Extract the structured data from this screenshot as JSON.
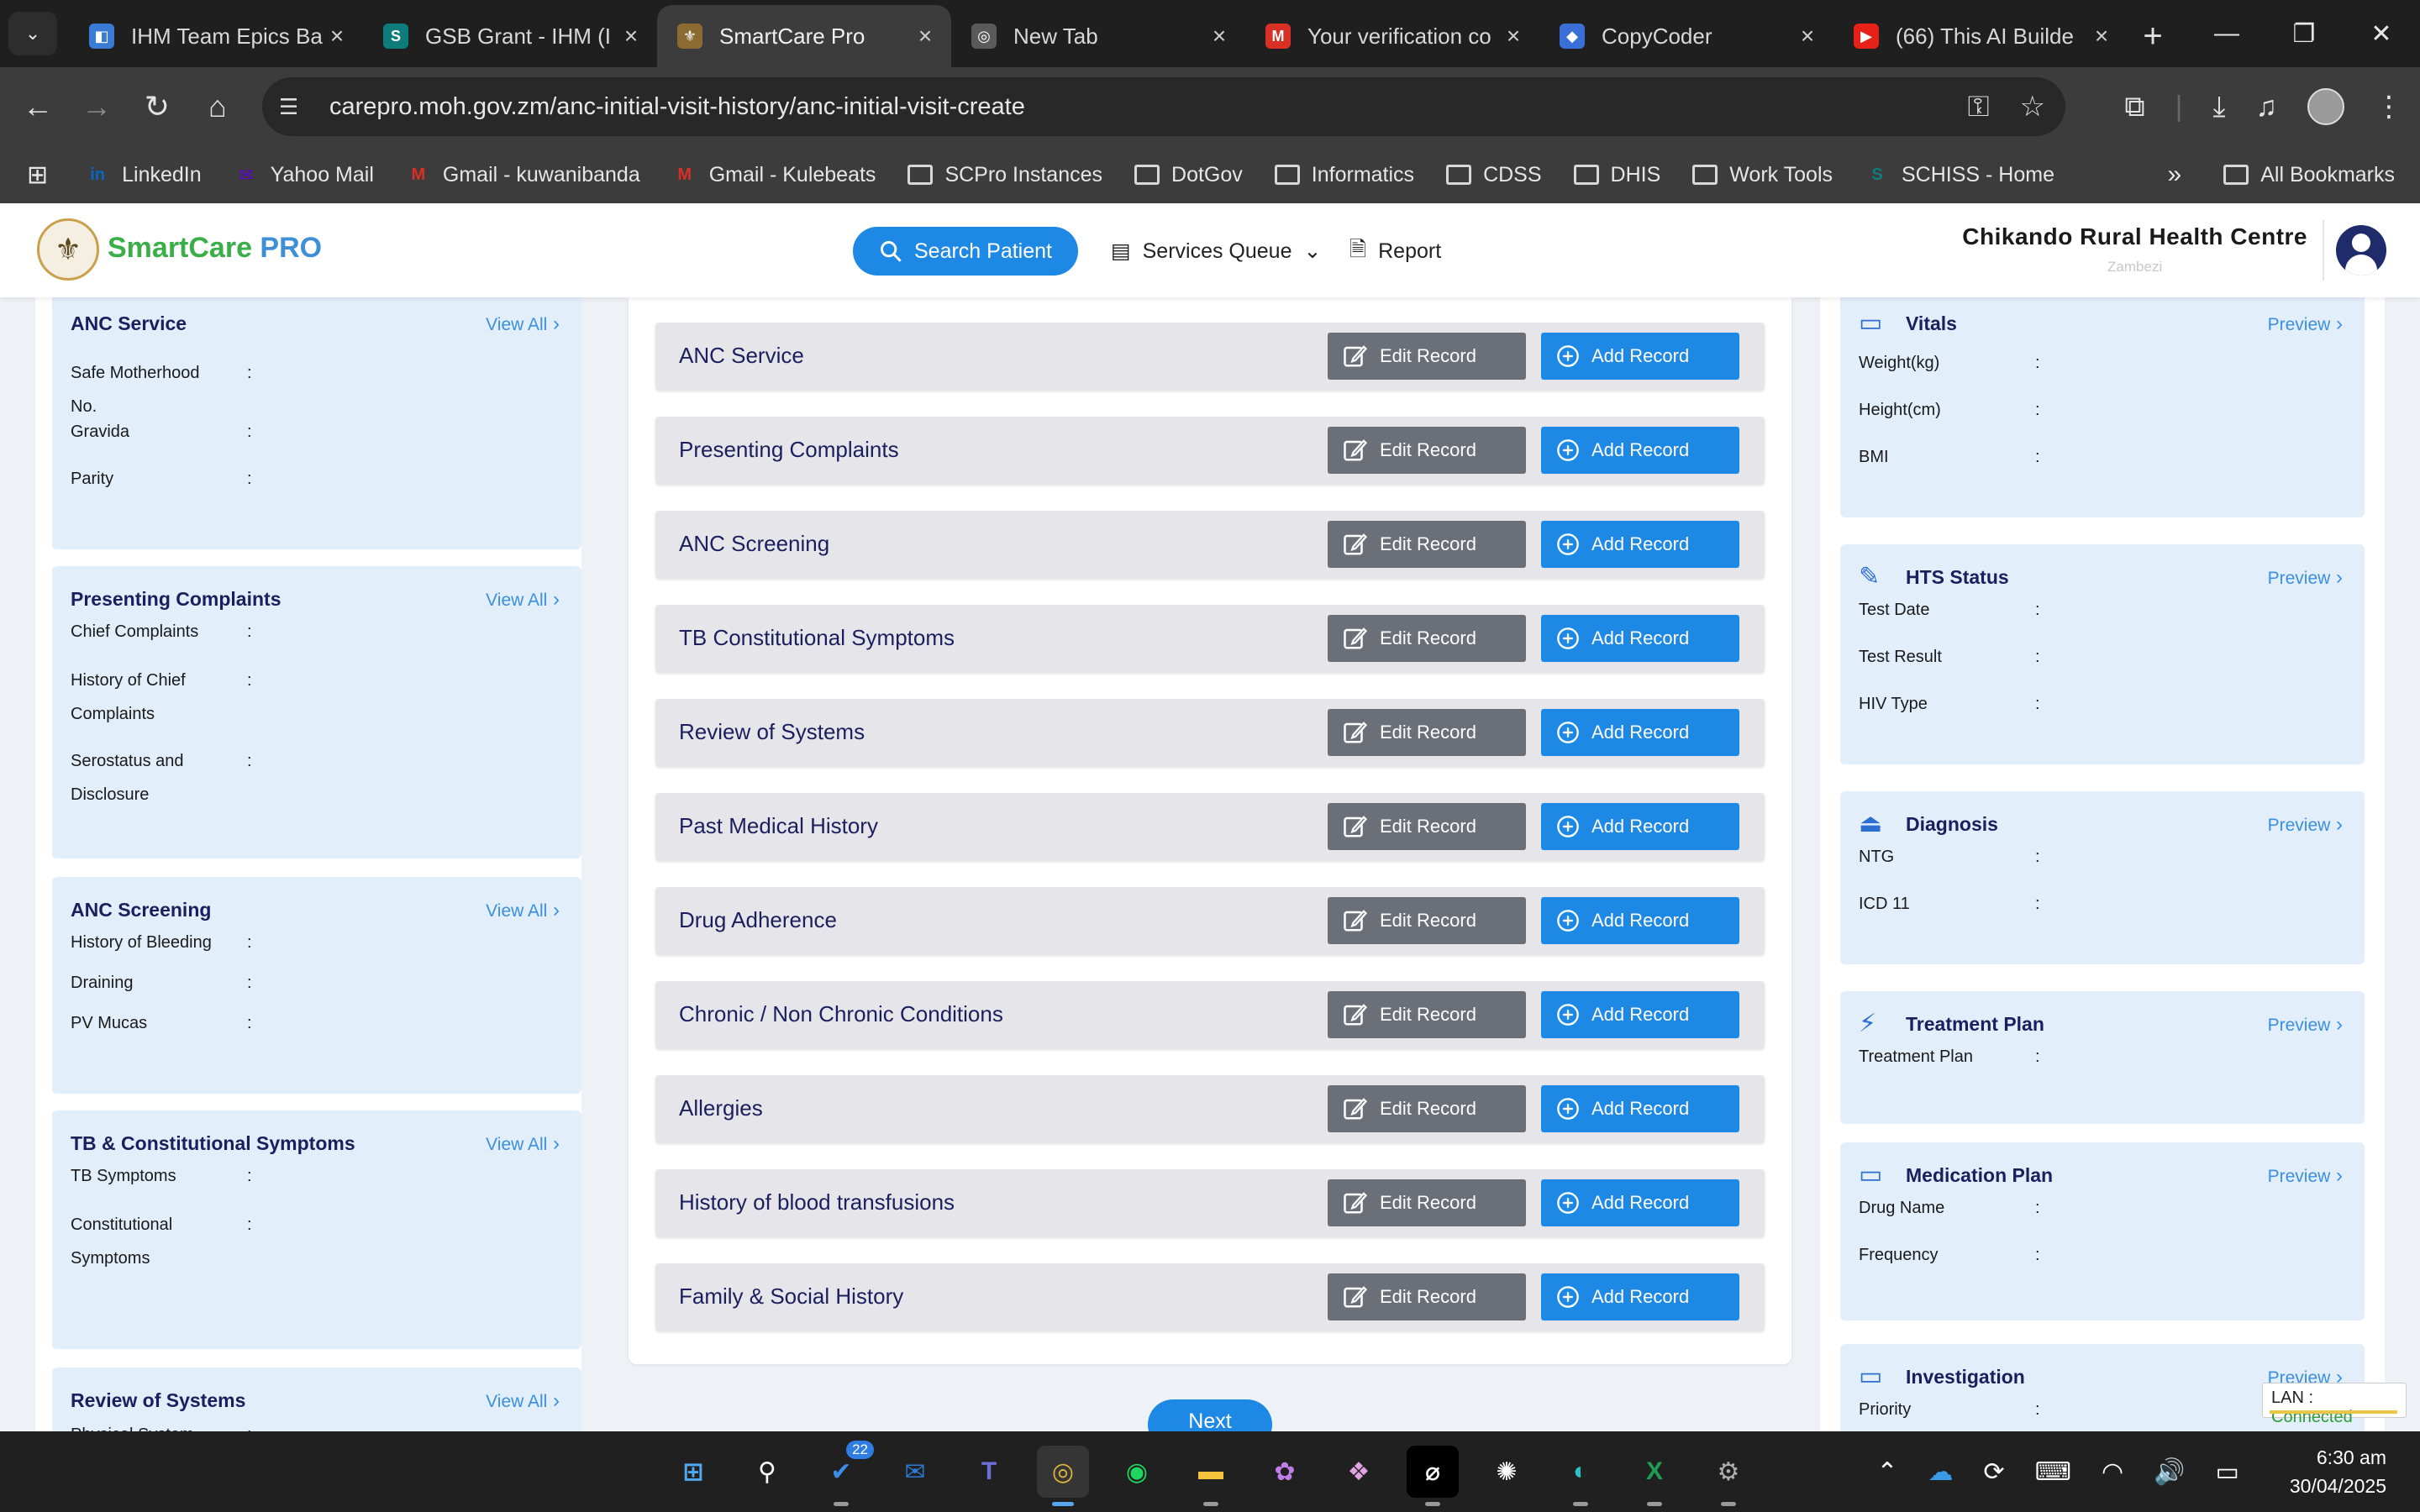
{
  "browser": {
    "tabs": [
      {
        "title": "IHM Team Epics Ba",
        "icon": "devops-icon",
        "color": "#3a7bd5",
        "glyph": "◧"
      },
      {
        "title": "GSB Grant - IHM (I",
        "icon": "sharepoint-icon",
        "color": "#0f7c7c",
        "glyph": "S"
      },
      {
        "title": "SmartCare Pro",
        "icon": "smartcare-icon",
        "color": "#8b6b32",
        "glyph": "⚜"
      },
      {
        "title": "New Tab",
        "icon": "chrome-icon",
        "color": "#5a5a5a",
        "glyph": "◎"
      },
      {
        "title": "Your verification co",
        "icon": "gmail-icon",
        "color": "#d93025",
        "glyph": "M"
      },
      {
        "title": "CopyCoder",
        "icon": "copycoder-icon",
        "color": "#3a6fd8",
        "glyph": "◆"
      },
      {
        "title": "(66) This AI Builde",
        "icon": "youtube-icon",
        "color": "#e62117",
        "glyph": "▶"
      }
    ],
    "url_host": "carepro.moh.gov.zm",
    "url_path": "/anc-initial-visit-history/anc-initial-visit-create",
    "bookmarks": [
      {
        "label": "LinkedIn",
        "icon": "linkedin-icon",
        "color": "#0a66c2",
        "glyph": "in"
      },
      {
        "label": "Yahoo Mail",
        "icon": "yahoo-mail-icon",
        "color": "#6001d2",
        "glyph": "✉"
      },
      {
        "label": "Gmail - kuwanibanda",
        "icon": "gmail-icon",
        "color": "#d93025",
        "glyph": "M"
      },
      {
        "label": "Gmail - Kulebeats",
        "icon": "gmail-icon",
        "color": "#d93025",
        "glyph": "M"
      },
      {
        "label": "SCPro Instances",
        "icon": "folder-icon"
      },
      {
        "label": "DotGov",
        "icon": "folder-icon"
      },
      {
        "label": "Informatics",
        "icon": "folder-icon"
      },
      {
        "label": "CDSS",
        "icon": "folder-icon"
      },
      {
        "label": "DHIS",
        "icon": "folder-icon"
      },
      {
        "label": "Work Tools",
        "icon": "folder-icon"
      },
      {
        "label": "SCHISS - Home",
        "icon": "sharepoint-icon",
        "color": "#0f7c7c",
        "glyph": "S"
      }
    ],
    "all_bookmarks": "All Bookmarks"
  },
  "app": {
    "brand_main": "SmartCare",
    "brand_pro": " PRO",
    "search_patient": "Search Patient",
    "services_queue": "Services Queue",
    "report": "Report",
    "facility_name": "Chikando Rural Health Centre",
    "facility_province": "Zambezi"
  },
  "left_cards": [
    {
      "title": "ANC Service",
      "link": "View All",
      "top": 0,
      "height": 0,
      "rows": [
        "Safe Motherhood No.",
        "Gravida",
        "Parity"
      ]
    },
    {
      "title": "Presenting Complaints",
      "link": "View All",
      "rows": [
        "Chief Complaints",
        "History of Chief Complaints",
        "Serostatus and Disclosure"
      ]
    },
    {
      "title": "ANC Screening",
      "link": "View All",
      "rows": [
        "History of Bleeding",
        "Draining",
        "PV Mucas"
      ]
    },
    {
      "title": "TB & Constitutional Symptoms",
      "link": "View All",
      "rows": [
        "TB Symptoms",
        "Constitutional Symptoms"
      ]
    },
    {
      "title": "Review of Systems",
      "link": "View All",
      "rows": [
        "Physical System"
      ]
    }
  ],
  "records": [
    "ANC Service",
    "Presenting Complaints",
    "ANC Screening",
    "TB Constitutional Symptoms",
    "Review of Systems",
    "Past Medical History",
    "Drug Adherence",
    "Chronic / Non Chronic Conditions",
    "Allergies",
    "History of blood transfusions",
    "Family & Social History"
  ],
  "record_buttons": {
    "edit": "Edit Record",
    "add": "Add Record"
  },
  "next_label": "Next",
  "right_cards": [
    {
      "title": "Vitals",
      "link": "Preview",
      "icon": "scale-icon",
      "rows": [
        "Weight(kg)",
        "Height(cm)",
        "BMI"
      ]
    },
    {
      "title": "HTS Status",
      "link": "Preview",
      "icon": "syringe-icon",
      "rows": [
        "Test Date",
        "Test Result",
        "HIV Type"
      ]
    },
    {
      "title": "Diagnosis",
      "link": "Preview",
      "icon": "siren-icon",
      "rows": [
        "NTG",
        "ICD 11"
      ]
    },
    {
      "title": "Treatment Plan",
      "link": "Preview",
      "icon": "bolt-icon",
      "rows": [
        "Treatment Plan"
      ]
    },
    {
      "title": "Medication Plan",
      "link": "Preview",
      "icon": "pill-icon",
      "rows": [
        "Drug Name",
        "Frequency"
      ]
    },
    {
      "title": "Investigation",
      "link": "Preview",
      "icon": "flask-icon",
      "rows": [
        "Priority"
      ]
    }
  ],
  "status": {
    "lan_label": "LAN : ",
    "lan_value": "Connected"
  },
  "taskbar": {
    "badge_count": "22",
    "time": "6:30 am",
    "date": "30/04/2025"
  }
}
